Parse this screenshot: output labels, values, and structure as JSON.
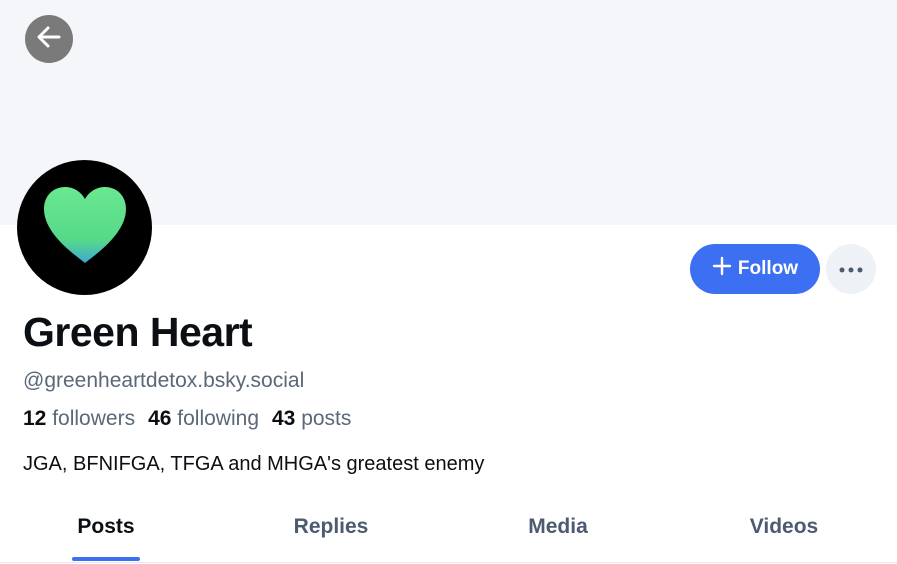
{
  "banner": {
    "back_icon": "arrow-left-icon"
  },
  "profile": {
    "avatar_icon": "green-heart-icon",
    "display_name": "Green Heart",
    "handle": "@greenheartdetox.bsky.social",
    "stats": [
      {
        "count": "12",
        "label": "followers"
      },
      {
        "count": "46",
        "label": "following"
      },
      {
        "count": "43",
        "label": "posts"
      }
    ],
    "bio": "JGA, BFNIFGA, TFGA and MHGA's greatest enemy"
  },
  "actions": {
    "follow_label": "Follow",
    "follow_icon": "plus-icon",
    "more_icon": "ellipsis-icon"
  },
  "tabs": [
    {
      "label": "Posts",
      "active": true
    },
    {
      "label": "Replies",
      "active": false
    },
    {
      "label": "Media",
      "active": false
    },
    {
      "label": "Videos",
      "active": false
    }
  ],
  "colors": {
    "accent": "#3d6ff2",
    "banner": "#f5f6fa",
    "heart_green": "#5fe08a",
    "heart_teal": "#3fb6c9"
  }
}
